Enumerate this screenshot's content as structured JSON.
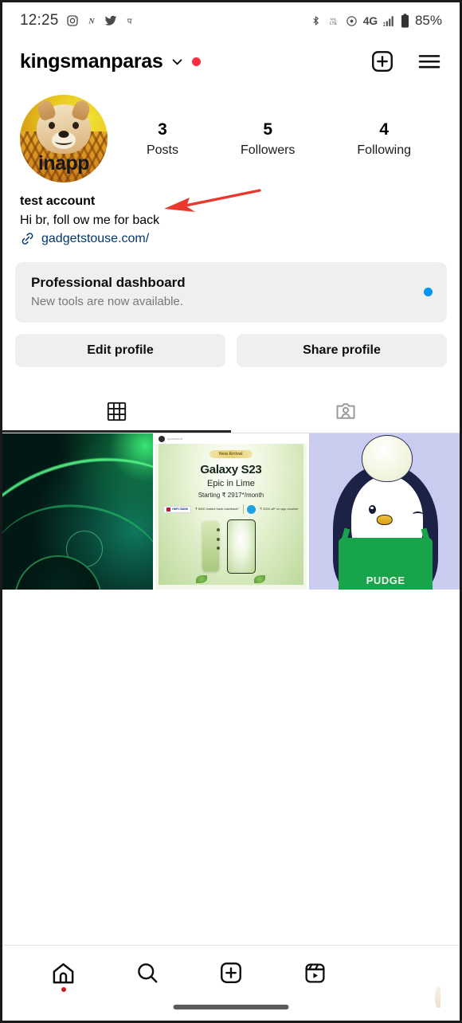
{
  "status_bar": {
    "time": "12:25",
    "left_icons": [
      "instagram-icon",
      "app-n-icon",
      "twitter-icon",
      "phonepe-icon"
    ],
    "right_icons": [
      "bluetooth-icon",
      "volte-icon",
      "hotspot-icon",
      "signal-bars-icon"
    ],
    "network": "4G",
    "battery": "85%"
  },
  "header": {
    "username": "kingsmanparas",
    "chevron": "chevron-down-icon",
    "notification_dot_color": "#ff2d3d",
    "create_icon": "plus-square-icon",
    "menu_icon": "hamburger-menu-icon"
  },
  "profile": {
    "avatar_name": "profile-avatar",
    "avatar_overlay_text": "inapp",
    "stats": [
      {
        "num": "3",
        "label": "Posts"
      },
      {
        "num": "5",
        "label": "Followers"
      },
      {
        "num": "4",
        "label": "Following"
      }
    ],
    "display_name": "test account",
    "bio": "Hi br, foll ow me for back",
    "link_icon": "link-icon",
    "link": "gadgetstouse.com/",
    "annotation": "red-arrow-pointing-to-link"
  },
  "dashboard": {
    "title": "Professional dashboard",
    "subtitle": "New tools are now available.",
    "dot_color": "#0095f6"
  },
  "actions": {
    "edit_profile": "Edit profile",
    "share_profile": "Share profile"
  },
  "tabs": [
    {
      "name": "grid-tab",
      "icon": "grid-icon",
      "active": true
    },
    {
      "name": "tagged-tab",
      "icon": "tagged-person-icon",
      "active": false
    }
  ],
  "grid_posts": [
    {
      "name": "post-abstract-green",
      "alt": "Dark abstract green wallpaper"
    },
    {
      "name": "post-galaxy-s23-ad",
      "badge": "New Arrival",
      "title": "Galaxy S23",
      "subtitle": "Epic in Lime",
      "price": "Starting ₹ 2917*/month",
      "offer1": "₹ 5000 instant bank cashback*",
      "offer2": "₹ 2000 off* on app voucher",
      "bank": "HDFC BANK"
    },
    {
      "name": "post-pudgy-penguin",
      "label": "PUDGE"
    }
  ],
  "bottom_nav": [
    {
      "name": "nav-home",
      "icon": "home-icon",
      "badge_dot": true
    },
    {
      "name": "nav-search",
      "icon": "search-icon",
      "badge_dot": false
    },
    {
      "name": "nav-create",
      "icon": "plus-square-icon",
      "badge_dot": false
    },
    {
      "name": "nav-reels",
      "icon": "reels-icon",
      "badge_dot": false
    },
    {
      "name": "nav-profile",
      "icon": "profile-avatar-icon",
      "badge_dot": false
    }
  ]
}
